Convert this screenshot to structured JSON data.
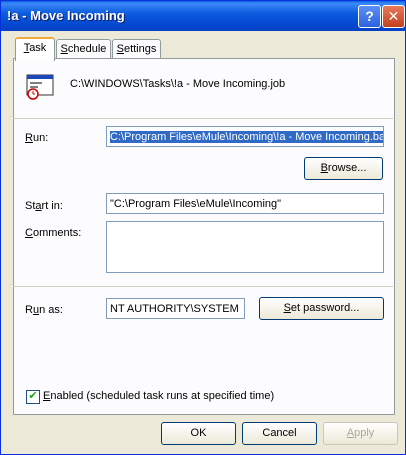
{
  "window": {
    "title": "!a - Move Incoming"
  },
  "tabs": [
    {
      "label": "Task",
      "underline": "T",
      "rest": "ask"
    },
    {
      "label": "Schedule",
      "underline": "S",
      "rest": "chedule"
    },
    {
      "label": "Settings",
      "underline": "S",
      "rest": "ettings"
    }
  ],
  "task": {
    "job_path": "C:\\WINDOWS\\Tasks\\!a - Move Incoming.job",
    "run": {
      "label_u": "R",
      "label_rest": "un:",
      "value": "C:\\Program Files\\eMule\\Incoming\\!a - Move Incoming.bat\""
    },
    "browse_button": {
      "u": "B",
      "rest": "rowse..."
    },
    "start_in": {
      "label_pre": "St",
      "label_u": "a",
      "label_post": "rt in:",
      "value": "\"C:\\Program Files\\eMule\\Incoming\""
    },
    "comments": {
      "label_u": "C",
      "label_rest": "omments:",
      "value": ""
    },
    "run_as": {
      "label_pre": "R",
      "label_u": "u",
      "label_post": "n as:",
      "value": "NT AUTHORITY\\SYSTEM"
    },
    "set_password_button": {
      "u": "S",
      "rest": "et password..."
    },
    "enabled": {
      "label_u": "E",
      "label_rest": "nabled (scheduled task runs at specified time)",
      "checked": true
    }
  },
  "buttons": {
    "ok": "OK",
    "cancel": "Cancel",
    "apply_u": "A",
    "apply_rest": "pply"
  }
}
